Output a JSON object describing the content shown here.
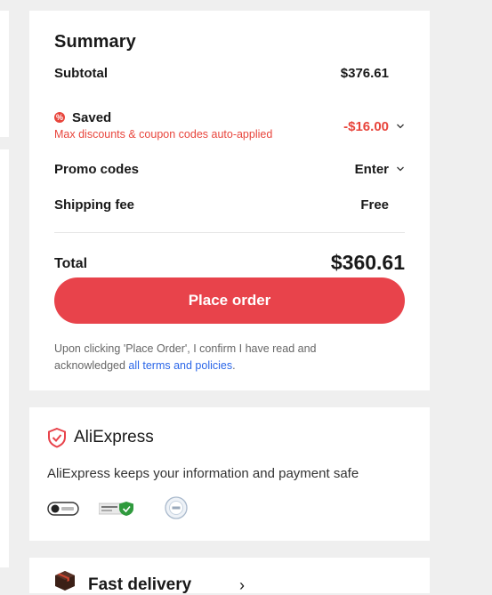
{
  "summary": {
    "title": "Summary",
    "subtotal_label": "Subtotal",
    "subtotal_value": "$376.61",
    "saved_label": "Saved",
    "saved_note": "Max discounts & coupon codes auto-applied",
    "saved_value": "-$16.00",
    "promo_label": "Promo codes",
    "promo_value": "Enter",
    "shipping_label": "Shipping fee",
    "shipping_value": "Free",
    "total_label": "Total",
    "total_value": "$360.61",
    "place_order_label": "Place order",
    "terms_text": "Upon clicking 'Place Order', I confirm I have read and acknowledged ",
    "terms_link": "all terms and policies",
    "terms_end": "."
  },
  "security": {
    "brand": "AliExpress",
    "safe_text": "AliExpress keeps your information and payment safe"
  },
  "delivery": {
    "label": "Fast delivery"
  },
  "colors": {
    "accent_red": "#e8434b",
    "saved_red": "#e8453c",
    "link_blue": "#2a66e8",
    "background": "#efefef"
  }
}
